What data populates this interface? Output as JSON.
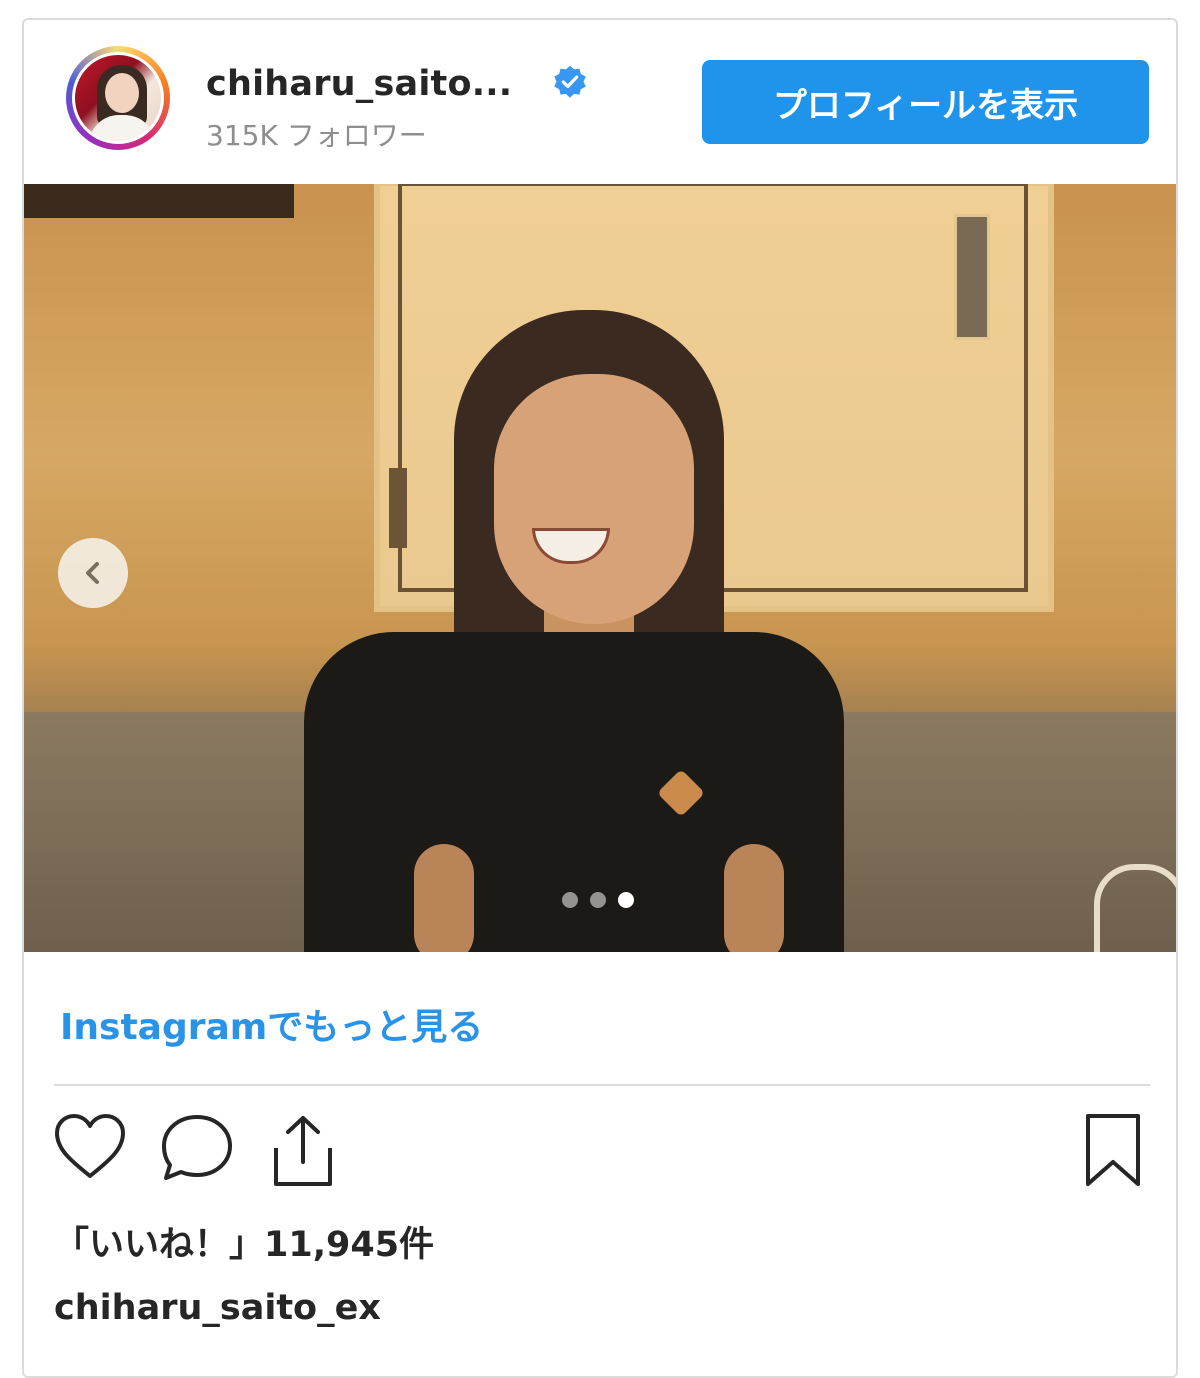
{
  "header": {
    "username": "chiharu_saito...",
    "followers": "315K フォロワー",
    "profile_button": "プロフィールを表示"
  },
  "carousel": {
    "slide_count": 3,
    "active_index": 2
  },
  "footer": {
    "more_link": "Instagramでもっと見る",
    "likes": "「いいね！」11,945件",
    "owner": "chiharu_saito_ex"
  },
  "colors": {
    "primary_button": "#1f94ea",
    "link": "#2a93e6",
    "verified": "#3897f0"
  },
  "icons": [
    "verified-badge-icon",
    "chevron-left-icon",
    "heart-icon",
    "comment-icon",
    "share-icon",
    "bookmark-icon"
  ]
}
